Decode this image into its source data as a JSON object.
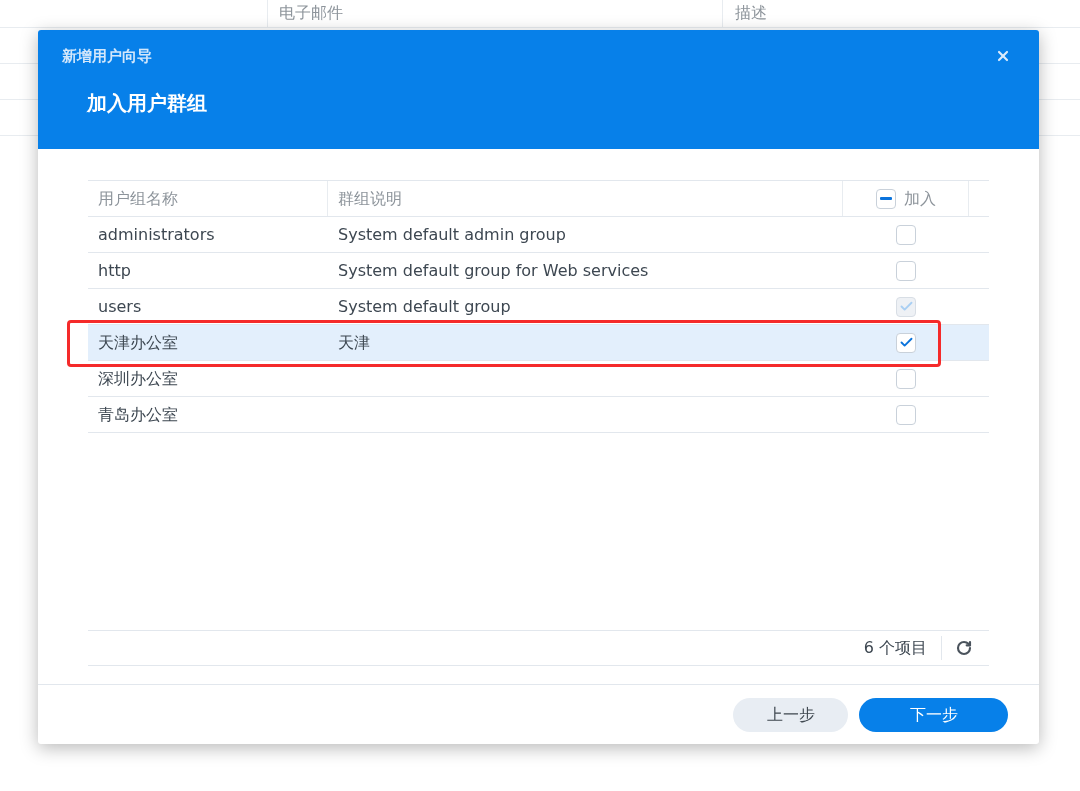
{
  "background_table": {
    "columns": [
      {
        "label": "电子邮件"
      },
      {
        "label": "描述"
      }
    ]
  },
  "dialog": {
    "title": "新增用户向导",
    "heading": "加入用户群组",
    "table": {
      "columns": [
        {
          "label": "用户组名称"
        },
        {
          "label": "群组说明"
        }
      ],
      "select_all": {
        "label": "加入",
        "indeterminate": true
      },
      "rows": [
        {
          "name": "administrators",
          "description": "System default admin group",
          "checked": false,
          "disabled": false,
          "selected": false,
          "highlighted": false
        },
        {
          "name": "http",
          "description": "System default group for Web services",
          "checked": false,
          "disabled": false,
          "selected": false,
          "highlighted": false
        },
        {
          "name": "users",
          "description": "System default group",
          "checked": true,
          "disabled": true,
          "selected": false,
          "highlighted": false
        },
        {
          "name": "天津办公室",
          "description": "天津",
          "checked": true,
          "disabled": false,
          "selected": true,
          "highlighted": true
        },
        {
          "name": "深圳办公室",
          "checked": false,
          "disabled": false,
          "selected": false,
          "highlighted": false
        },
        {
          "name": "青岛办公室",
          "checked": false,
          "disabled": false,
          "selected": false,
          "highlighted": false
        }
      ],
      "count": "6 个项目"
    },
    "buttons": [
      {
        "label": "上一步",
        "kind": "secondary"
      },
      {
        "label": "下一步",
        "kind": "primary"
      }
    ]
  }
}
